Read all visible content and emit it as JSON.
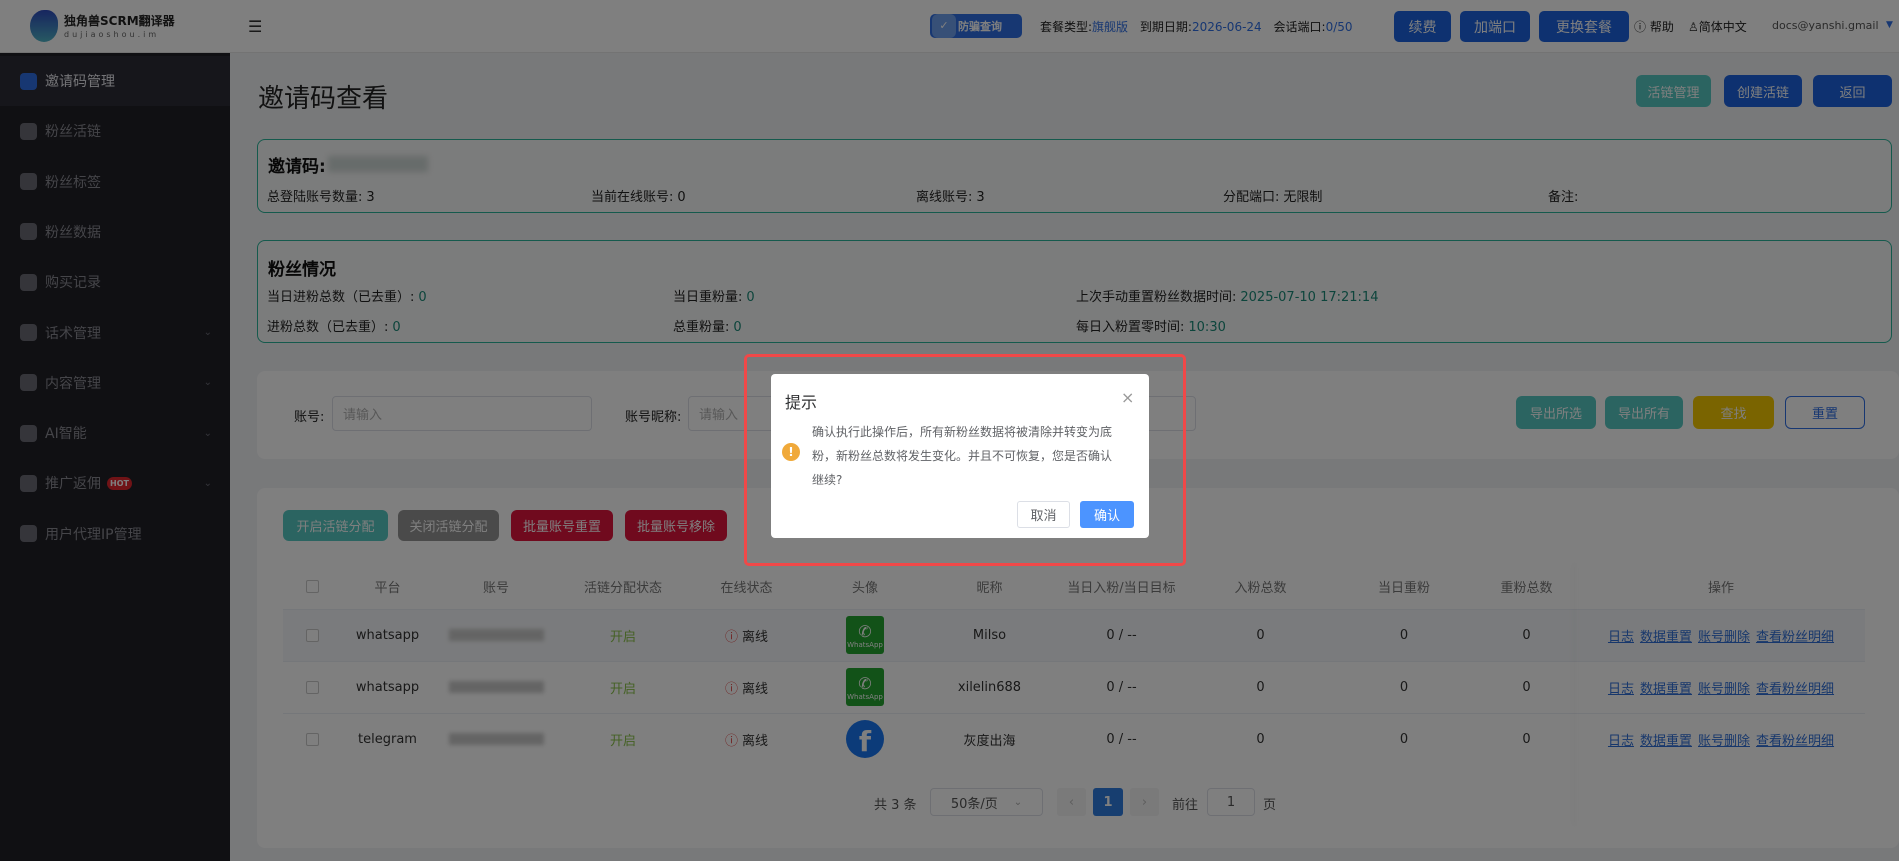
{
  "header": {
    "brand": "独角兽SCRM翻译器",
    "brand_sub": "dujiaoshou.im",
    "anti_fraud": "防骗查询",
    "plan_label": "套餐类型:",
    "plan_value": "旗舰版",
    "expire_label": "到期日期:",
    "expire_value": "2026-06-24",
    "ports_label": "会话端口:",
    "ports_value": "0/50",
    "renew": "续费",
    "add_port": "加端口",
    "change_plan": "更换套餐",
    "help": "帮助",
    "language": "简体中文",
    "email": "docs@yanshi.gmail"
  },
  "sidebar": {
    "items": [
      {
        "label": "邀请码管理"
      },
      {
        "label": "粉丝活链"
      },
      {
        "label": "粉丝标签"
      },
      {
        "label": "粉丝数据"
      },
      {
        "label": "购买记录"
      },
      {
        "label": "话术管理"
      },
      {
        "label": "内容管理"
      },
      {
        "label": "AI智能"
      },
      {
        "label": "推广返佣",
        "badge": "HOT"
      },
      {
        "label": "用户代理IP管理"
      }
    ]
  },
  "page": {
    "title": "邀请码查看",
    "btn_link_mgmt": "活链管理",
    "btn_create_link": "创建活链",
    "btn_back": "返回"
  },
  "invite": {
    "title": "邀请码:",
    "total_label": "总登陆账号数量:",
    "total": "3",
    "online_label": "当前在线账号:",
    "online": "0",
    "offline_label": "离线账号:",
    "offline": "3",
    "ports_label": "分配端口:",
    "ports": "无限制",
    "note_label": "备注:"
  },
  "fans": {
    "title": "粉丝情况",
    "today_in_label": "当日进粉总数（已去重）:",
    "today_in": "0",
    "today_dup_label": "当日重粉量:",
    "today_dup": "0",
    "last_reset_label": "上次手动重置粉丝数据时间:",
    "last_reset": "2025-07-10 17:21:14",
    "total_in_label": "进粉总数（已去重）:",
    "total_in": "0",
    "total_dup_label": "总重粉量:",
    "total_dup": "0",
    "daily_zero_label": "每日入粉置零时间:",
    "daily_zero": "10:30"
  },
  "filter": {
    "account_label": "账号:",
    "account_placeholder": "请输入",
    "nickname_label": "账号昵称:",
    "nickname_placeholder": "请输入",
    "export_selected": "导出所选",
    "export_all": "导出所有",
    "search": "查找",
    "reset": "重置"
  },
  "batch": {
    "enable": "开启活链分配",
    "disable": "关闭活链分配",
    "reset": "批量账号重置",
    "remove": "批量账号移除"
  },
  "table": {
    "columns": [
      "平台",
      "账号",
      "活链分配状态",
      "在线状态",
      "头像",
      "昵称",
      "当日入粉/当日目标",
      "入粉总数",
      "当日重粉",
      "重粉总数",
      "操作"
    ],
    "rows": [
      {
        "platform": "whatsapp",
        "status": "开启",
        "online": "离线",
        "avatar": "whatsapp",
        "nickname": "Milso",
        "today": "0 / --",
        "total": "0",
        "today_dup": "0",
        "dup_total": "0"
      },
      {
        "platform": "whatsapp",
        "status": "开启",
        "online": "离线",
        "avatar": "whatsapp",
        "nickname": "xilelin688",
        "today": "0 / --",
        "total": "0",
        "today_dup": "0",
        "dup_total": "0"
      },
      {
        "platform": "telegram",
        "status": "开启",
        "online": "离线",
        "avatar": "facebook",
        "nickname": "灰度出海",
        "today": "0 / --",
        "total": "0",
        "today_dup": "0",
        "dup_total": "0"
      }
    ],
    "actions": [
      "日志",
      "数据重置",
      "账号删除",
      "查看粉丝明细"
    ],
    "wa_text": "WhatsApp"
  },
  "pagination": {
    "total": "共 3 条",
    "page_size": "50条/页",
    "current": "1",
    "goto_label": "前往",
    "goto_value": "1",
    "page_suffix": "页"
  },
  "modal": {
    "title": "提示",
    "message": "确认执行此操作后，所有新粉丝数据将被清除并转变为底粉，新粉丝总数将发生变化。并且不可恢复，您是否确认继续?",
    "cancel": "取消",
    "confirm": "确认"
  },
  "colors": {
    "accent": "#1c63e0",
    "teal": "#2bb59a",
    "danger": "#e0143c",
    "warning": "#f0a93a"
  }
}
